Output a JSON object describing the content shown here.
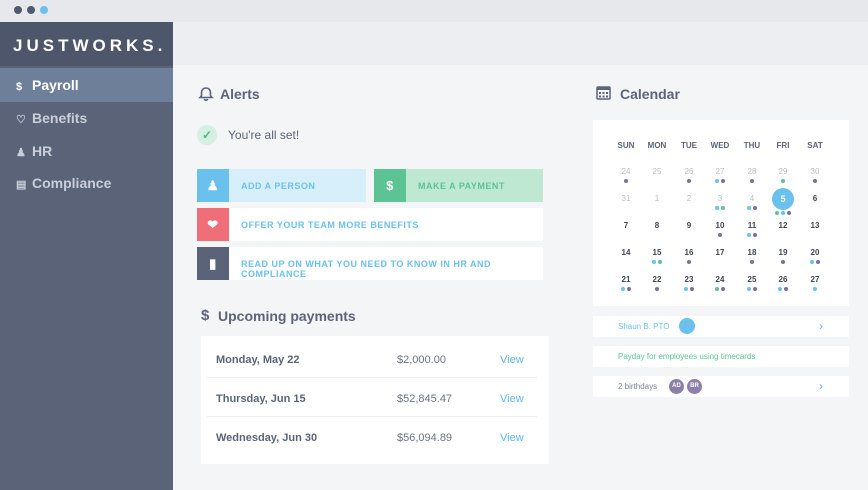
{
  "window_controls": [
    {
      "color": "#4f5a6e"
    },
    {
      "color": "#4f5a6e"
    },
    {
      "color": "#6bc1ee"
    }
  ],
  "brand": "JUSTWORKS.",
  "nav": [
    {
      "label": "Payroll",
      "icon": "dollar-icon",
      "glyph": "$",
      "active": true
    },
    {
      "label": "Benefits",
      "icon": "heart-icon",
      "glyph": "♡",
      "active": false
    },
    {
      "label": "HR",
      "icon": "people-icon",
      "glyph": "☗",
      "active": false
    },
    {
      "label": "Compliance",
      "icon": "clipboard-icon",
      "glyph": "▤",
      "active": false
    }
  ],
  "alerts": {
    "title": "Alerts",
    "status": "You're all set!",
    "actions": [
      {
        "label": "ADD A PERSON",
        "icon": "person-icon",
        "color": "#6bc1ee",
        "bg": "#d7effb",
        "text": "#6bc1ee"
      },
      {
        "label": "MAKE A PAYMENT",
        "icon": "dollar-icon",
        "color": "#5cc395",
        "bg": "#bfe8d3",
        "text": "#5cc395"
      },
      {
        "label": "OFFER YOUR TEAM MORE BENEFITS",
        "icon": "heart-icon",
        "color": "#f06e78",
        "bg": "#ffffff",
        "text": "#6bc1ee"
      },
      {
        "label": "READ UP ON WHAT YOU NEED TO KNOW IN HR AND COMPLIANCE",
        "icon": "book-icon",
        "color": "#5a6377",
        "bg": "#ffffff",
        "text": "#6bc1ee"
      }
    ]
  },
  "payments": {
    "title": "Upcoming payments",
    "rows": [
      {
        "date": "Monday, May 22",
        "amount": "$2,000.00",
        "action": "View"
      },
      {
        "date": "Thursday, Jun 15",
        "amount": "$52,845.47",
        "action": "View"
      },
      {
        "date": "Wednesday, Jun 30",
        "amount": "$56,094.89",
        "action": "View"
      }
    ]
  },
  "calendar": {
    "title": "Calendar",
    "weekdays": [
      "SUN",
      "MON",
      "TUE",
      "WED",
      "THU",
      "FRI",
      "SAT"
    ],
    "today": "5",
    "weeks": [
      [
        {
          "d": "24",
          "m": true,
          "dots": [
            "p"
          ]
        },
        {
          "d": "25",
          "m": true,
          "dots": []
        },
        {
          "d": "26",
          "m": true,
          "dots": [
            "p"
          ]
        },
        {
          "d": "27",
          "m": true,
          "dots": [
            "b",
            "p"
          ]
        },
        {
          "d": "28",
          "m": true,
          "dots": [
            "p"
          ]
        },
        {
          "d": "29",
          "m": true,
          "dots": [
            "g"
          ]
        },
        {
          "d": "30",
          "m": true,
          "dots": [
            "p"
          ]
        }
      ],
      [
        {
          "d": "31",
          "m": true,
          "dots": []
        },
        {
          "d": "1",
          "m": true,
          "dots": []
        },
        {
          "d": "2",
          "m": true,
          "dots": []
        },
        {
          "d": "3",
          "m": true,
          "dots": [
            "b",
            "g"
          ]
        },
        {
          "d": "4",
          "m": true,
          "dots": [
            "b",
            "p"
          ]
        },
        {
          "d": "5",
          "m": false,
          "dots": [
            "g",
            "b",
            "p"
          ],
          "today": true
        },
        {
          "d": "6",
          "m": false,
          "dots": []
        }
      ],
      [
        {
          "d": "7",
          "m": false,
          "dots": []
        },
        {
          "d": "8",
          "m": false,
          "dots": []
        },
        {
          "d": "9",
          "m": false,
          "dots": []
        },
        {
          "d": "10",
          "m": false,
          "dots": [
            "p"
          ]
        },
        {
          "d": "11",
          "m": false,
          "dots": [
            "b",
            "p"
          ]
        },
        {
          "d": "12",
          "m": false,
          "dots": []
        },
        {
          "d": "13",
          "m": false,
          "dots": []
        }
      ],
      [
        {
          "d": "14",
          "m": false,
          "dots": []
        },
        {
          "d": "15",
          "m": false,
          "dots": [
            "b",
            "g"
          ]
        },
        {
          "d": "16",
          "m": false,
          "dots": [
            "p"
          ]
        },
        {
          "d": "17",
          "m": false,
          "dots": []
        },
        {
          "d": "18",
          "m": false,
          "dots": [
            "p"
          ]
        },
        {
          "d": "19",
          "m": false,
          "dots": [
            "p"
          ]
        },
        {
          "d": "20",
          "m": false,
          "dots": [
            "b",
            "p"
          ]
        }
      ],
      [
        {
          "d": "21",
          "m": false,
          "dots": [
            "b",
            "p"
          ]
        },
        {
          "d": "22",
          "m": false,
          "dots": [
            "p"
          ]
        },
        {
          "d": "23",
          "m": false,
          "dots": [
            "b",
            "p"
          ]
        },
        {
          "d": "24",
          "m": false,
          "dots": [
            "g",
            "p"
          ]
        },
        {
          "d": "25",
          "m": false,
          "dots": [
            "b",
            "p"
          ]
        },
        {
          "d": "26",
          "m": false,
          "dots": [
            "b",
            "p"
          ]
        },
        {
          "d": "27",
          "m": false,
          "dots": [
            "b"
          ]
        }
      ]
    ],
    "events": [
      {
        "text": "Shaun B. PTO",
        "color": "#6bc1ee",
        "has_chevron": true,
        "avatars": [
          {
            "label": "",
            "color": "#6bc1ee"
          }
        ]
      },
      {
        "text": "Payday for employees using timecards",
        "color": "#5cc395",
        "has_chevron": false,
        "avatars": []
      },
      {
        "text": "2 birthdays",
        "color": "#7b8597",
        "has_chevron": true,
        "avatars": [
          {
            "label": "AD",
            "color": "#8e7fa8"
          },
          {
            "label": "BR",
            "color": "#8e7fa8"
          }
        ]
      }
    ]
  }
}
